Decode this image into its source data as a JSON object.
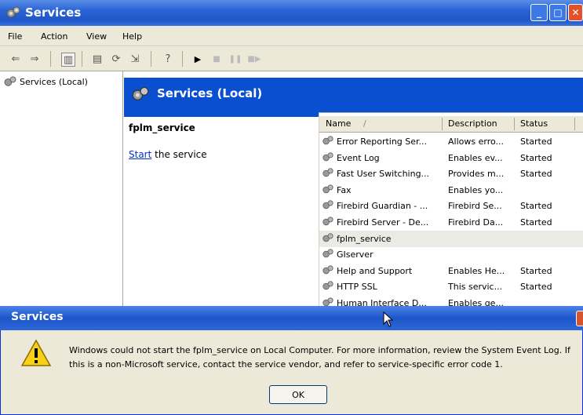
{
  "window": {
    "title": "Services"
  },
  "menu": [
    "File",
    "Action",
    "View",
    "Help"
  ],
  "tree": {
    "root_label": "Services (Local)"
  },
  "panel": {
    "header": "Services (Local)",
    "selected_service": "fplm_service",
    "start_link": "Start",
    "start_suffix": " the service"
  },
  "list": {
    "columns": [
      "Name",
      "Description",
      "Status"
    ],
    "sort_indicator": "/",
    "rows": [
      {
        "name": "Error Reporting Ser...",
        "description": "Allows erro...",
        "status": "Started"
      },
      {
        "name": "Event Log",
        "description": "Enables ev...",
        "status": "Started"
      },
      {
        "name": "Fast User Switching...",
        "description": "Provides m...",
        "status": "Started"
      },
      {
        "name": "Fax",
        "description": "Enables yo...",
        "status": ""
      },
      {
        "name": "Firebird Guardian - ...",
        "description": "Firebird Se...",
        "status": "Started"
      },
      {
        "name": "Firebird Server - De...",
        "description": "Firebird Da...",
        "status": "Started"
      },
      {
        "name": "fplm_service",
        "description": "",
        "status": "",
        "selected": true
      },
      {
        "name": "GIserver",
        "description": "",
        "status": ""
      },
      {
        "name": "Help and Support",
        "description": "Enables He...",
        "status": "Started"
      },
      {
        "name": "HTTP SSL",
        "description": "This servic...",
        "status": "Started"
      },
      {
        "name": "Human Interface D...",
        "description": "Enables ge...",
        "status": ""
      }
    ]
  },
  "dialog": {
    "title": "Services",
    "message_line1": "Windows could not start the fplm_service on Local Computer. For more information, review the System Event Log. If",
    "message_line2": "this is a non-Microsoft service, contact the service vendor, and refer to service-specific error code 1.",
    "ok_label": "OK"
  },
  "colors": {
    "title_blue": "#2a63d6",
    "header_blue": "#0b4fd1",
    "dialog_bg": "#ece9d8",
    "link": "#0033cc"
  },
  "icons": [
    "services-gear-icon",
    "warning-icon",
    "back-icon",
    "forward-icon",
    "play-icon",
    "stop-icon",
    "pause-icon",
    "restart-icon"
  ]
}
